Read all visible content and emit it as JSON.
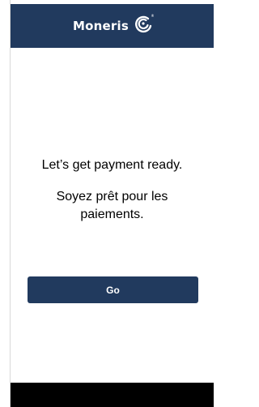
{
  "header": {
    "brand_name": "Moneris",
    "logo_icon": "moneris-swirl-icon",
    "background_color": "#213a5e"
  },
  "main": {
    "headline": "Let’s get payment ready.",
    "subline": "Soyez prêt pour les paiements.",
    "go_button_label": "Go",
    "button_color": "#213a5e"
  }
}
